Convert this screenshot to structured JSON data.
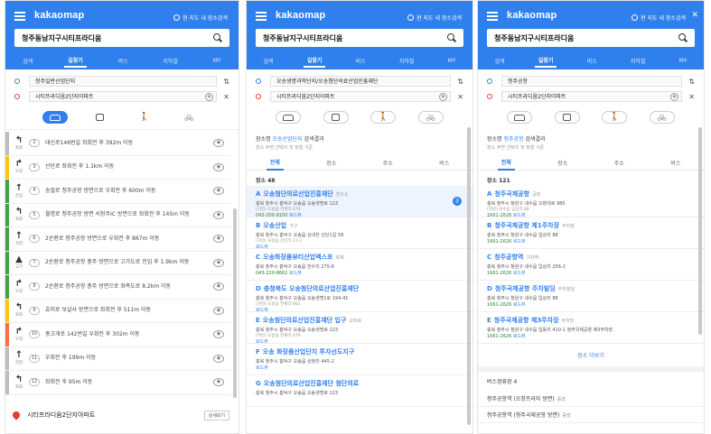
{
  "app": {
    "logo": "kakaomap",
    "map_search": "현 지도 내 장소검색"
  },
  "panels": [
    {
      "query": "청주동남지구시티프라디움"
    },
    {
      "query": "청주동남지구시티프라디움"
    },
    {
      "query": "청주동남지구시티프라디움"
    }
  ],
  "tabs": [
    "검색",
    "길찾기",
    "버스",
    "지하철",
    "MY"
  ],
  "route1": {
    "from": "청주일반산업단지",
    "to": "시티프라디움2단지아파트",
    "steps": [
      {
        "num": "2",
        "arrow": "↰",
        "dir": "좌회",
        "text": "대신로146번길 좌회전 후 392m 이동",
        "color": "#bdbdbd"
      },
      {
        "num": "3",
        "arrow": "↱",
        "dir": "우회",
        "text": "산단로 좌회전 후 1.1km 이동",
        "color": "#f9c80e"
      },
      {
        "num": "4",
        "arrow": "↑",
        "dir": "진입",
        "text": "송절로 청주공항 방면으로 우회전 후 600m 이동",
        "color": "#43a047"
      },
      {
        "num": "5",
        "arrow": "↰",
        "dir": "좌회",
        "text": "월명로 청주공항 방면 서청주IC 방면으로 좌회전 후 145m 이동",
        "color": "#43a047"
      },
      {
        "num": "6",
        "arrow": "↑",
        "dir": "직진",
        "text": "2순환로 청주공항 방면으로 우회전 후 867m 이동",
        "color": "#43a047"
      },
      {
        "num": "7",
        "arrow": "▲",
        "dir": "고가",
        "text": "2순환로 청주공항 충주 방면으로 고가도로 진입 후 1.9km 이동",
        "color": "#43a047"
      },
      {
        "num": "8",
        "arrow": "↱",
        "dir": "우회",
        "text": "2순환로 청주공항 충주 방면으로 좌측도로 8.2km 이동",
        "color": "#43a047"
      },
      {
        "num": "9",
        "arrow": "↰",
        "dir": "좌회",
        "text": "효미로 보살사 방면으로 좌회전 후 511m 이동",
        "color": "#f9c80e"
      },
      {
        "num": "10",
        "arrow": "↱",
        "dir": "우회",
        "text": "중고개로 142번길 우회전 후 302m 이동",
        "color": "#ff7043"
      },
      {
        "num": "11",
        "arrow": "↑",
        "dir": "직진",
        "text": "우회전 후 199m 이동",
        "color": "#bdbdbd"
      },
      {
        "num": "12",
        "arrow": "↰",
        "dir": "좌회",
        "text": "좌회전 후 95m 이동",
        "color": "#bdbdbd"
      }
    ],
    "dest": "시티프라디움2단지아파트",
    "dest_btn": "상세보기"
  },
  "route2": {
    "from": "오송생명과학단지/오송첨단의료산업진흥재단",
    "to": "시티프라디움2단지아파트",
    "info_prefix": "장소명",
    "info_highlight": "오송산업단지",
    "info_suffix": "검색결과",
    "info_sub": "장소 주변 선택지 및 정렬 기준",
    "content_tabs": [
      "전체",
      "장소",
      "주소",
      "버스"
    ],
    "section": "장소 48",
    "results": [
      {
        "letter": "A",
        "title": "오송첨단의료산업진흥재단",
        "cat": "연구소",
        "addr": "충북 청주시 흥덕구 오송읍 오송생명로 123",
        "sub": "(지번) 오송읍 연제리 679",
        "phone": "043-200-9100",
        "review": "로드뷰",
        "selected": true
      },
      {
        "letter": "B",
        "title": "오송산업",
        "cat": "가구",
        "addr": "충북 청주시 흥덕구 오송읍 상내천 산단1길 58",
        "sub": "(지번) 오송읍 산단리 21-2",
        "phone": "",
        "review": "로드뷰",
        "selected": false
      },
      {
        "letter": "C",
        "title": "오송화장품뷰티산업엑스포",
        "cat": "축제",
        "addr": "충북 청주시 흥덕구 오송읍 만수리 275-6",
        "sub": "",
        "phone": "043-220-8662",
        "review": "로드뷰",
        "selected": false
      },
      {
        "letter": "D",
        "title": "충청북도 오송첨단의료산업진흥재단",
        "cat": "",
        "addr": "충북 청주시 흥덕구 오송읍 오송생명1로 194-41",
        "sub": "(지번) 오송읍 연제리 661",
        "phone": "",
        "review": "로드뷰",
        "selected": false
      },
      {
        "letter": "E",
        "title": "오송첨단의료산업진흥재단 입구",
        "cat": "교차로",
        "addr": "충북 청주시 흥덕구 오송읍 오송생명로 123",
        "sub": "(지번) 오송읍 연제리 679",
        "phone": "",
        "review": "로드뷰",
        "selected": false
      },
      {
        "letter": "F",
        "title": "오송 화장품산업단지 투자선도지구",
        "cat": "",
        "addr": "충북 청주시 흥덕구 오송읍 상정리 445-2",
        "sub": "",
        "phone": "",
        "review": "로드뷰",
        "selected": false
      },
      {
        "letter": "G",
        "title": "오송첨단의료산업진흥재단 첨단의료",
        "cat": "",
        "addr": "충북 청주시 흥덕구 오송읍 오송생명로 123",
        "sub": "",
        "phone": "",
        "review": "",
        "selected": false
      }
    ]
  },
  "route3": {
    "from": "청주공항",
    "to": "시티프라디움2단지아파트",
    "info_prefix": "장소명",
    "info_highlight": "청주공항",
    "info_suffix": "검색결과",
    "info_sub": "장소 주변 선택지 및 정렬 기준",
    "content_tabs": [
      "전체",
      "장소",
      "주소",
      "버스"
    ],
    "section": "장소 121",
    "results": [
      {
        "letter": "A",
        "title": "청주국제공항",
        "cat": "공항",
        "addr": "충북 청주시 청원구 내수읍 오창대로 980",
        "sub": "(지번) 내수읍 입상리 88",
        "phone": "1661-2626",
        "review": "로드뷰",
        "selected": false
      },
      {
        "letter": "B",
        "title": "청주국제공항 제1주차장",
        "cat": "주차장",
        "addr": "충북 청주시 청원구 내수읍 입상리 88",
        "sub": "",
        "phone": "1661-2626",
        "review": "로드뷰",
        "selected": false
      },
      {
        "letter": "C",
        "title": "청주공항역",
        "cat": "기차역",
        "addr": "충북 청주시 청원구 내수읍 입상리 256-2",
        "sub": "",
        "phone": "1661-2626",
        "review": "로드뷰",
        "selected": false
      },
      {
        "letter": "D",
        "title": "청주국제공항 주차빌딩",
        "cat": "주차빌딩",
        "addr": "충북 청주시 청원구 내수읍 입상리 88",
        "sub": "",
        "phone": "1661-2626",
        "review": "로드뷰",
        "selected": false
      },
      {
        "letter": "E",
        "title": "청주국제공항 제3주차장",
        "cat": "주차장",
        "addr": "충북 청주시 청원구 내수읍 입동리 410-1 청주국제공항 제3주차장",
        "sub": "",
        "phone": "1661-2626",
        "review": "로드뷰",
        "selected": false
      }
    ],
    "more": "장소 더보기",
    "bus_section": "버스정류장 4",
    "bus_items": [
      {
        "name": "청주공항역 (오창프라자 방면)",
        "sub": "중앙"
      },
      {
        "name": "청주공항역 (청주국제공항 방면)",
        "sub": "중앙"
      }
    ]
  }
}
